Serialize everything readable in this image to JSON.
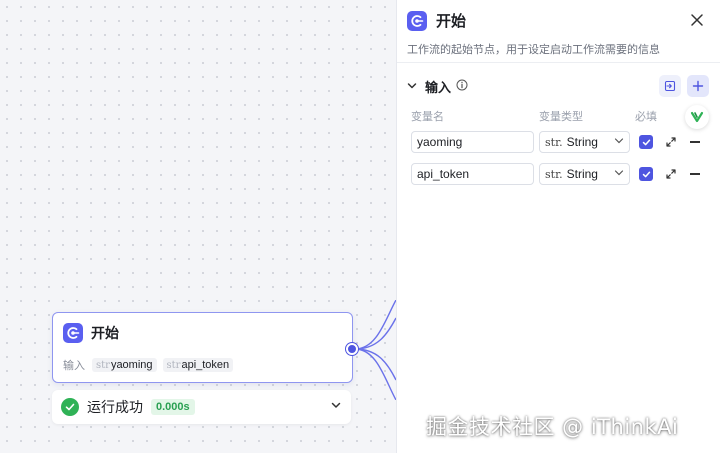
{
  "canvas": {
    "node": {
      "title": "开始",
      "inputs_label": "输入",
      "type_prefix": "str",
      "variables": [
        "yaoming",
        "api_token"
      ]
    },
    "run_status": {
      "text": "运行成功",
      "duration": "0.000s"
    }
  },
  "panel": {
    "title": "开始",
    "description": "工作流的起始节点，用于设定启动工作流需要的信息",
    "input_section_title": "输入",
    "columns": {
      "name": "变量名",
      "type": "变量类型",
      "required": "必填"
    },
    "rows": [
      {
        "name": "yaoming",
        "type_prefix": "str.",
        "type": "String",
        "required": true
      },
      {
        "name": "api_token",
        "type_prefix": "str.",
        "type": "String",
        "required": true
      }
    ]
  },
  "watermark": "掘金技术社区 @ iThinkAi",
  "colors": {
    "accent": "#5a5ff0",
    "success": "#2fb256",
    "node_border": "#8f96f0"
  },
  "icons": {
    "app": "start-node-icon",
    "close": "close-icon",
    "collapse": "chevron-down-icon",
    "info": "info-icon",
    "import": "import-icon",
    "add": "plus-icon",
    "expand": "expand-icon",
    "remove": "minus-icon",
    "success": "check-circle-icon"
  }
}
